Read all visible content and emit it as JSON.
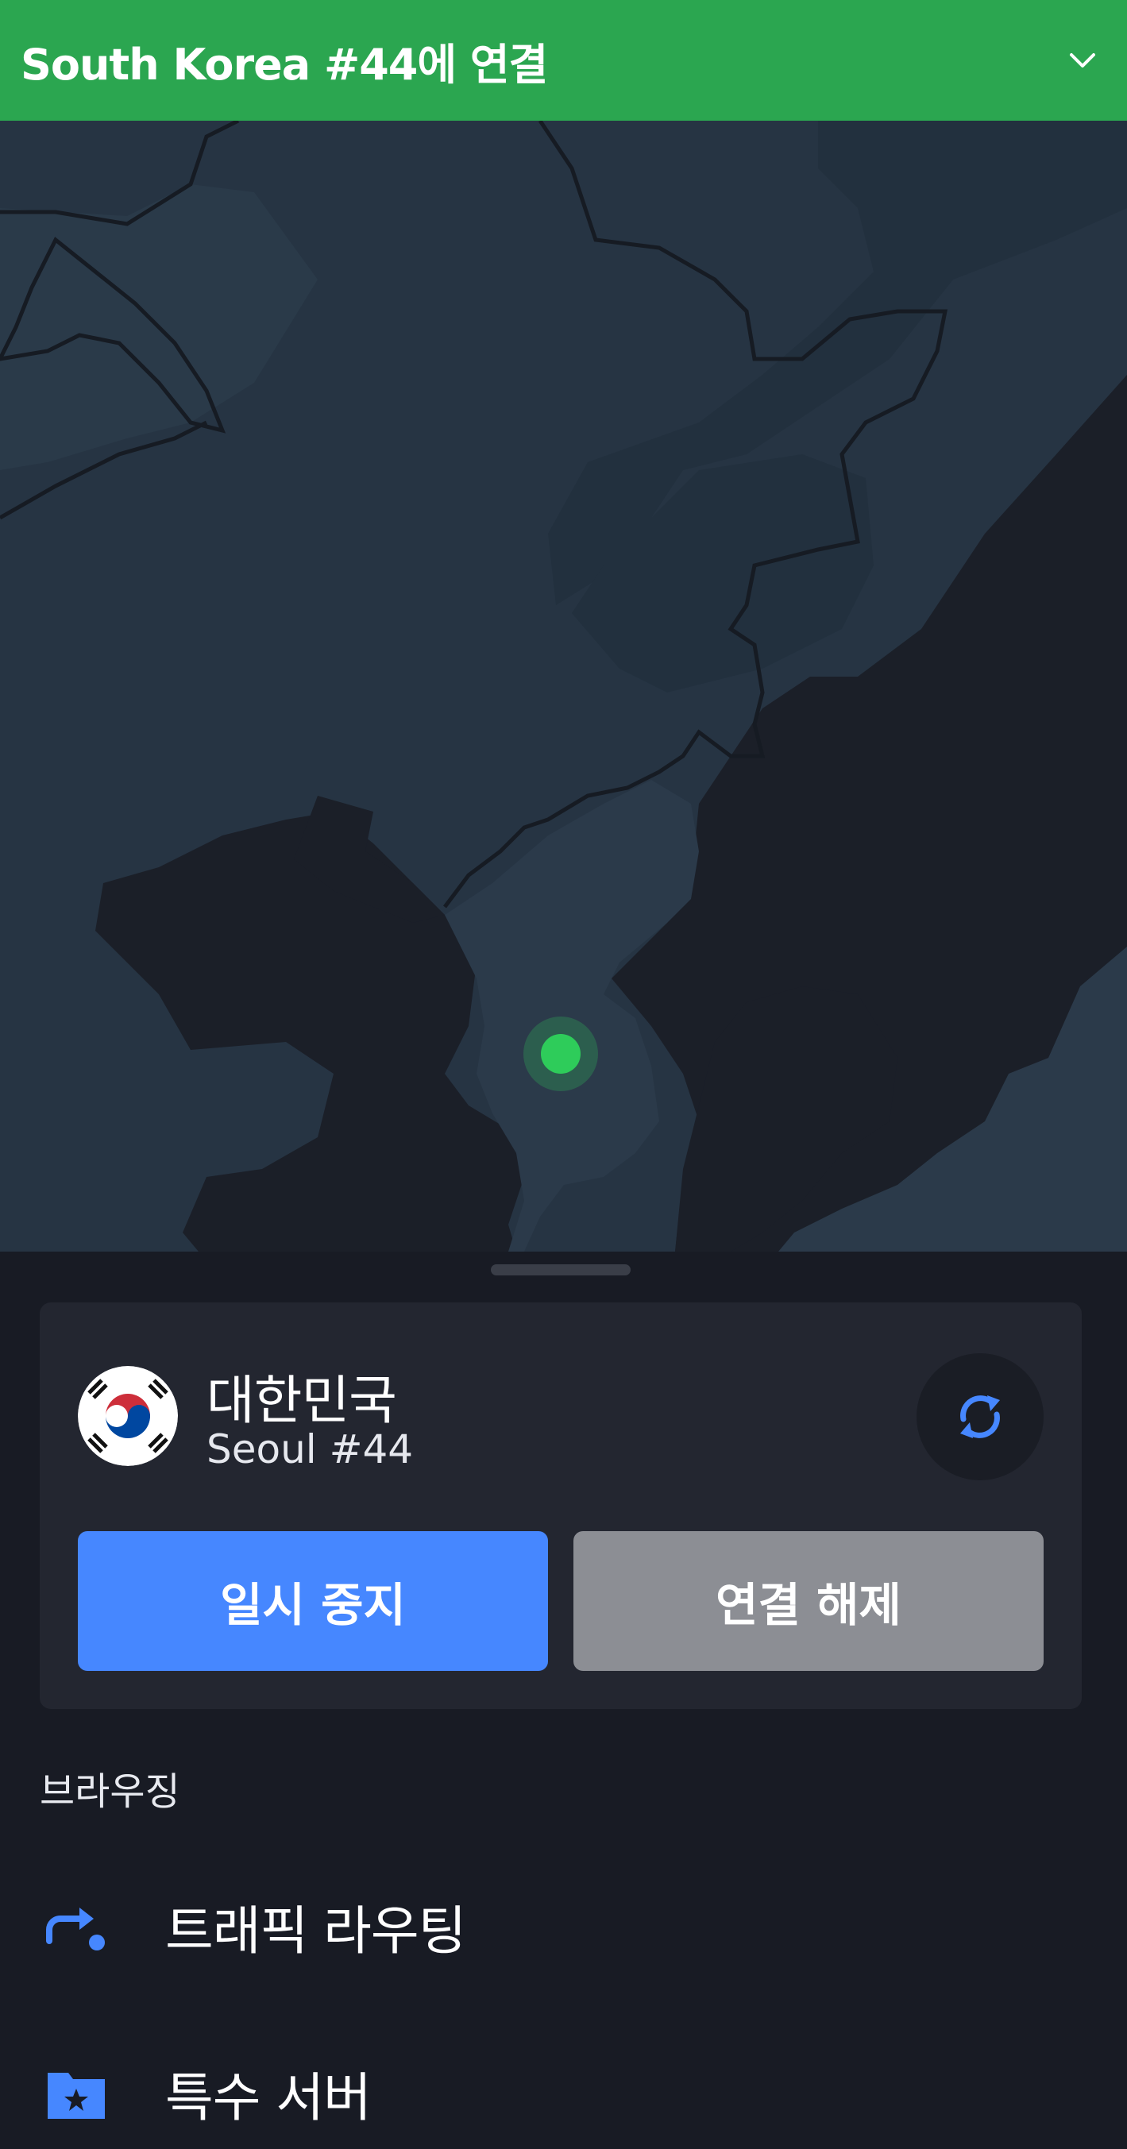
{
  "header": {
    "title": "South Korea #44에 연결",
    "background": "#2ba650"
  },
  "map": {
    "marker_color": "#2ecc5a"
  },
  "connection": {
    "country": "대한민국",
    "server": "Seoul #44",
    "pause_label": "일시 중지",
    "disconnect_label": "연결 해제",
    "pause_color": "#4687ff",
    "disconnect_color": "#8c8e94"
  },
  "browsing": {
    "section_label": "브라우징",
    "items": [
      {
        "label": "트래픽 라우팅",
        "icon": "route-arrow-icon"
      },
      {
        "label": "특수 서버",
        "icon": "star-folder-icon"
      }
    ]
  }
}
